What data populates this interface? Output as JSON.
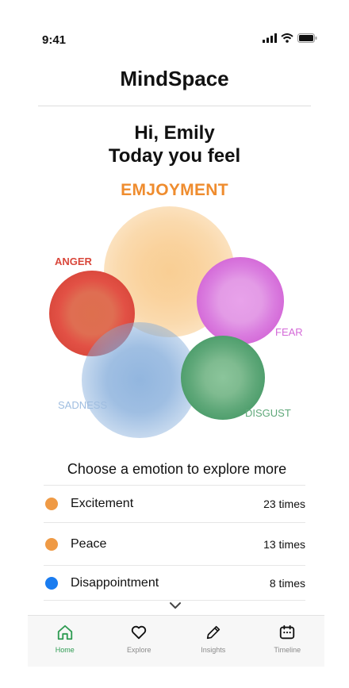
{
  "status_bar": {
    "time": "9:41",
    "icons": [
      "signal-icon",
      "wifi-icon",
      "battery-icon"
    ]
  },
  "header": {
    "title": "MindSpace"
  },
  "greeting": {
    "line1": "Hi, Emily",
    "line2": "Today you feel"
  },
  "current_emotion": {
    "label": "EMJOYMENT",
    "color": "#ef8c2e"
  },
  "bubbles": [
    {
      "id": "enjoyment",
      "label": "",
      "color": "#f4a63c"
    },
    {
      "id": "anger",
      "label": "ANGER",
      "color": "#d9473b"
    },
    {
      "id": "fear",
      "label": "FEAR",
      "color": "#d46ad8"
    },
    {
      "id": "sadness",
      "label": "SADNESS",
      "color": "#7fa9d9"
    },
    {
      "id": "disgust",
      "label": "DISGUST",
      "color": "#4b9c6a"
    }
  ],
  "explore": {
    "title": "Choose a emotion to explore more",
    "items": [
      {
        "name": "Excitement",
        "count": "23 times",
        "color": "#ef9a45"
      },
      {
        "name": "Peace",
        "count": "13 times",
        "color": "#ef9a45"
      },
      {
        "name": "Disappointment",
        "count": "8 times",
        "color": "#1a7cf0"
      }
    ]
  },
  "tabs": [
    {
      "label": "Home",
      "icon": "home-icon",
      "active": true
    },
    {
      "label": "Explore",
      "icon": "heart-icon",
      "active": false
    },
    {
      "label": "Insights",
      "icon": "pencil-icon",
      "active": false
    },
    {
      "label": "Timeline",
      "icon": "calendar-icon",
      "active": false
    }
  ],
  "colors": {
    "active_tab": "#2e9b52",
    "inactive_tab": "#8a8a8a"
  }
}
